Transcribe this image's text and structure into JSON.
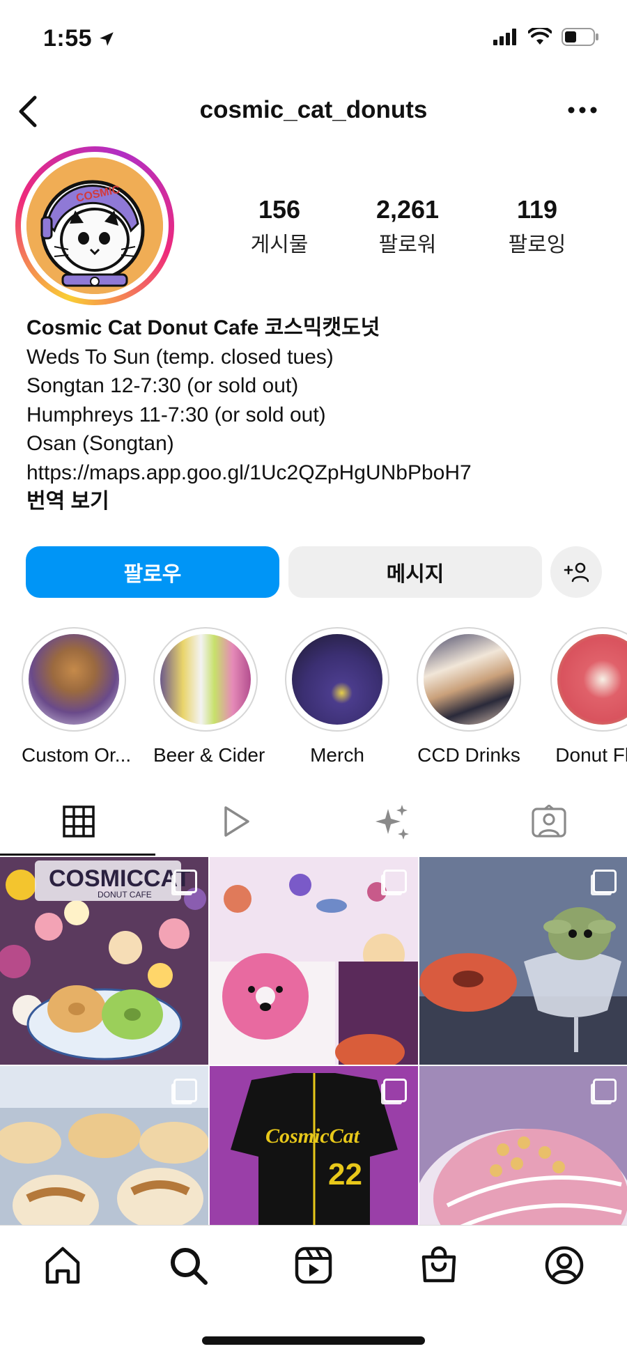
{
  "status_bar": {
    "time": "1:55"
  },
  "header": {
    "username": "cosmic_cat_donuts"
  },
  "stats": [
    {
      "value": "156",
      "label": "게시물"
    },
    {
      "value": "2,261",
      "label": "팔로워"
    },
    {
      "value": "119",
      "label": "팔로잉"
    }
  ],
  "bio": {
    "name": "Cosmic Cat Donut Cafe 코스믹캣도넛",
    "lines": [
      "Weds To Sun (temp. closed tues)",
      "Songtan 12-7:30 (or sold out)",
      "Humphreys 11-7:30 (or sold out)",
      "Osan (Songtan)",
      "https://maps.app.goo.gl/1Uc2QZpHgUNbPboH7"
    ],
    "translate": "번역 보기"
  },
  "actions": {
    "follow": "팔로우",
    "message": "메시지"
  },
  "avatar_text": "COSMIC",
  "highlights": [
    {
      "label": "Custom Or..."
    },
    {
      "label": "Beer & Cider"
    },
    {
      "label": "Merch"
    },
    {
      "label": "CCD Drinks"
    },
    {
      "label": "Donut Flav"
    }
  ],
  "posts": [
    {
      "overlay_text": "COSMICCAT",
      "overlay_sub": "DONUT CAFE",
      "icon": "carousel-icon"
    },
    {
      "overlay_text": "",
      "icon": "carousel-icon"
    },
    {
      "overlay_text": "",
      "icon": "carousel-icon"
    },
    {
      "overlay_text": "",
      "icon": "carousel-icon"
    },
    {
      "overlay_text": "CosmicCat",
      "overlay_sub": "22",
      "icon": "carousel-icon"
    },
    {
      "overlay_text": "",
      "icon": "carousel-icon"
    }
  ],
  "colors": {
    "follow_button": "#0095f6",
    "secondary_button": "#efefef"
  }
}
